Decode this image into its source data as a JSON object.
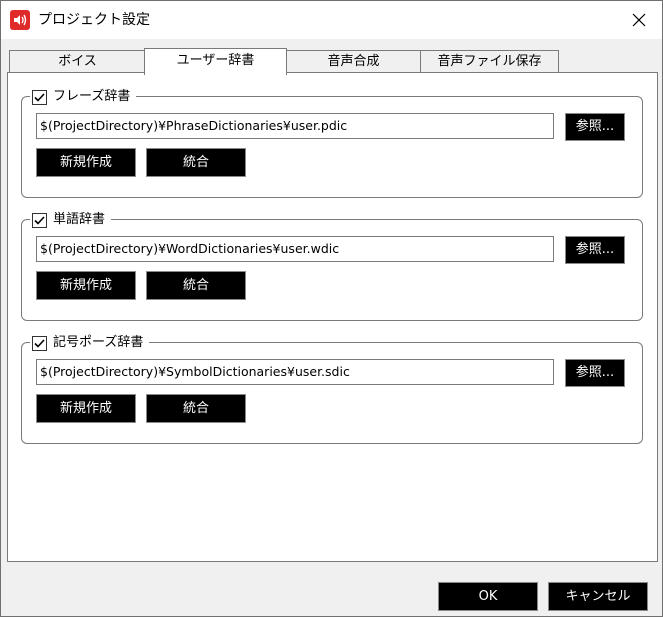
{
  "window": {
    "title": "プロジェクト設定"
  },
  "tabs": [
    {
      "label": "ボイス"
    },
    {
      "label": "ユーザー辞書"
    },
    {
      "label": "音声合成"
    },
    {
      "label": "音声ファイル保存"
    }
  ],
  "dictionaries": [
    {
      "label": "フレーズ辞書",
      "checked": true,
      "path": "$(ProjectDirectory)¥PhraseDictionaries¥user.pdic",
      "browse_label": "参照...",
      "new_label": "新規作成",
      "merge_label": "統合"
    },
    {
      "label": "単語辞書",
      "checked": true,
      "path": "$(ProjectDirectory)¥WordDictionaries¥user.wdic",
      "browse_label": "参照...",
      "new_label": "新規作成",
      "merge_label": "統合"
    },
    {
      "label": "記号ポーズ辞書",
      "checked": true,
      "path": "$(ProjectDirectory)¥SymbolDictionaries¥user.sdic",
      "browse_label": "参照...",
      "new_label": "新規作成",
      "merge_label": "統合"
    }
  ],
  "footer": {
    "ok_label": "OK",
    "cancel_label": "キャンセル"
  },
  "colors": {
    "app_icon": "#e02a2a",
    "button_bg": "#000000",
    "button_text": "#ffffff"
  }
}
